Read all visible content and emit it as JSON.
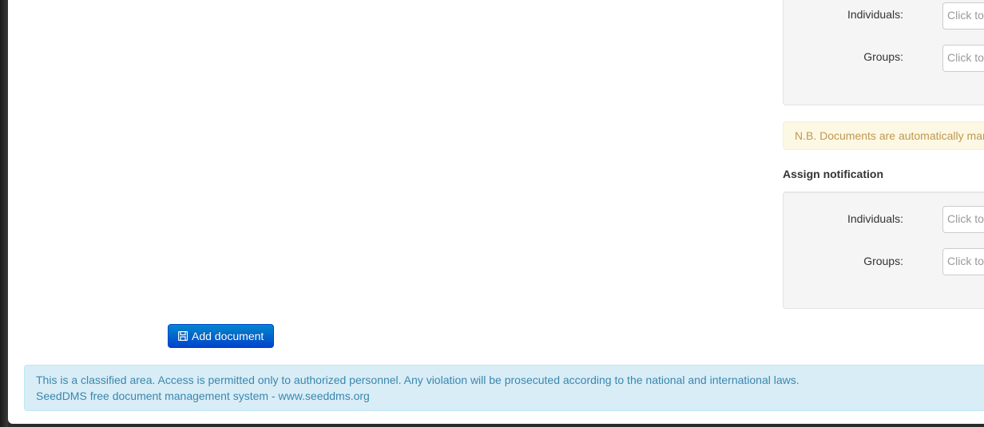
{
  "notify_top": {
    "individuals_label": "Individuals:",
    "individuals_placeholder": "Click to",
    "groups_label": "Groups:",
    "groups_placeholder": "Click to"
  },
  "notice": {
    "text": "N.B. Documents are automatically mar"
  },
  "assign_notification": {
    "legend": "Assign notification",
    "individuals_label": "Individuals:",
    "individuals_placeholder": "Click to",
    "groups_label": "Groups:",
    "groups_placeholder": "Click to"
  },
  "actions": {
    "add_document_label": "Add document",
    "add_document_icon": "save-icon"
  },
  "footer": {
    "disclaimer": "This is a classified area. Access is permitted only to authorized personnel. Any violation will be prosecuted according to the national and international laws.",
    "credit": "SeedDMS free document management system - www.seeddms.org"
  },
  "colors": {
    "primary_button": "#0055cc",
    "warning_bg": "#fcf8e3",
    "warning_text": "#c09853",
    "info_bg": "#d9edf7",
    "info_text": "#3a87ad"
  }
}
